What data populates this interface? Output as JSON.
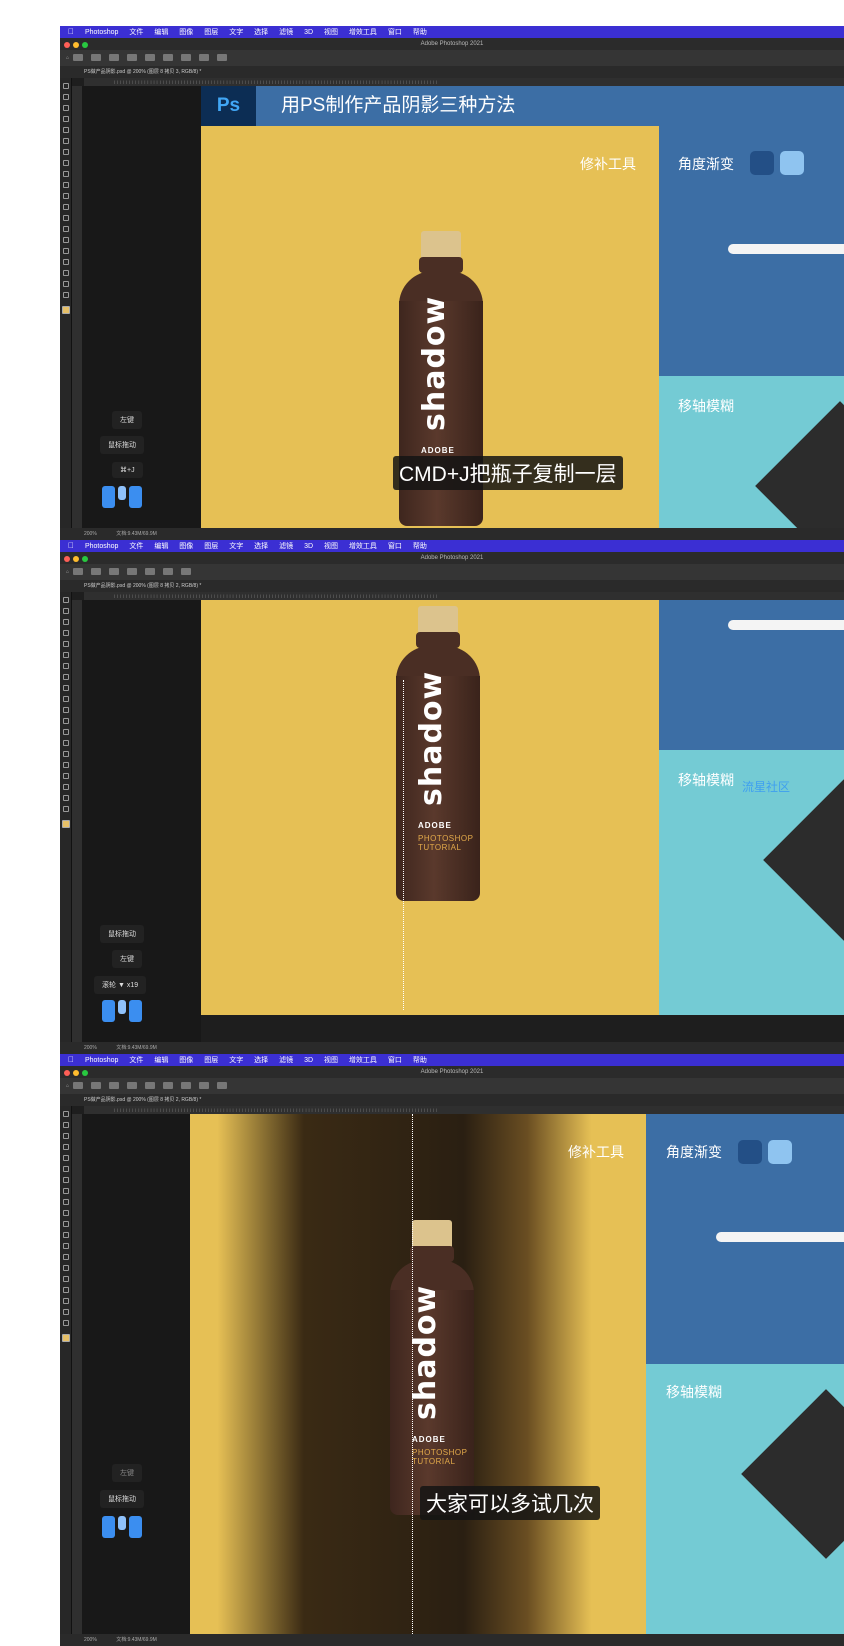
{
  "menu": {
    "items": [
      "Photoshop",
      "文件",
      "编辑",
      "图像",
      "图层",
      "文字",
      "选择",
      "滤镜",
      "3D",
      "视图",
      "增效工具",
      "窗口",
      "帮助"
    ]
  },
  "window_title": "Adobe Photoshop 2021",
  "panel1": {
    "doc_tab": "PS做产品阴影.psd @ 200% (图层 8 拷贝 3, RGB/8) *",
    "status_zoom": "200%",
    "status_doc": "文档:9.43M/69.9M",
    "banner_logo": "Ps",
    "banner_title": "用PS制作产品阴影三种方法",
    "label_patch": "修补工具",
    "label_angle": "角度渐变",
    "label_tilt": "移轴模糊",
    "key1": "左键",
    "key2": "鼠标拖动",
    "key3": "⌘+J",
    "subtitle": "CMD+J把瓶子复制一层",
    "bottle_brand": "shadow",
    "bottle_adobe": "ADOBE"
  },
  "panel2": {
    "doc_tab": "PS做产品阴影.psd @ 200% (图层 8 拷贝 2, RGB/8) *",
    "status_zoom": "200%",
    "status_doc": "文档:9.43M/69.9M",
    "label_tilt": "移轴模糊",
    "watermark": "流星社区",
    "key1": "鼠标拖动",
    "key2": "左键",
    "key3": "滚轮 ▼ x19",
    "bottle_brand": "shadow",
    "bottle_adobe": "ADOBE",
    "bottle_tut": "PHOTOSHOP TUTORIAL"
  },
  "panel3": {
    "doc_tab": "PS做产品阴影.psd @ 200% (图层 8 拷贝 2, RGB/8) *",
    "status_zoom": "200%",
    "status_doc": "文档:9.43M/69.9M",
    "label_patch": "修补工具",
    "label_angle": "角度渐变",
    "label_tilt": "移轴模糊",
    "key1": "左键",
    "key2": "鼠标拖动",
    "subtitle": "大家可以多试几次",
    "bottle_brand": "shadow",
    "bottle_adobe": "ADOBE",
    "bottle_tut": "PHOTOSHOP TUTORIAL"
  },
  "colors": {
    "menubar": "#3b2fd3",
    "canvas_yellow": "#e6c055",
    "blue_band": "#3c6ea5",
    "cyan_band": "#74cbd4",
    "mouse_blue": "#3b8ef0"
  }
}
